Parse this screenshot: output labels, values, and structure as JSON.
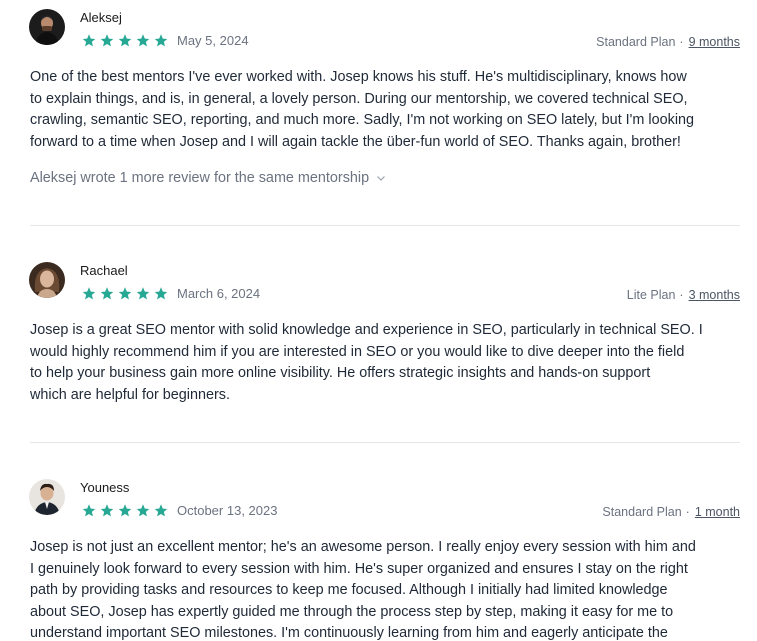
{
  "colors": {
    "star": "#27a894",
    "muted": "#6b7280",
    "text": "#1f2937",
    "divider": "#e5e7eb"
  },
  "reviews": [
    {
      "avatar_icon": "avatar-photo",
      "name": "Aleksej",
      "rating": 5,
      "date": "May 5, 2024",
      "plan": "Standard Plan",
      "separator": "·",
      "duration": "9 months",
      "lines": [
        "One of the best mentors I've ever worked with. Josep knows his stuff. He's multidisciplinary, knows how",
        "to explain things, and is, in general, a lovely person. During our mentorship, we covered technical SEO,",
        "crawling, semantic SEO, reporting, and much more. Sadly, I'm not working on SEO lately, but I'm looking",
        "forward to a time when Josep and I will again tackle the über-fun world of SEO. Thanks again, brother!"
      ],
      "more_reviews": "Aleksej wrote 1 more review for the same mentorship"
    },
    {
      "avatar_icon": "avatar-photo",
      "name": "Rachael",
      "rating": 5,
      "date": "March 6, 2024",
      "plan": "Lite Plan",
      "separator": "·",
      "duration": "3 months",
      "lines": [
        "Josep is a great SEO mentor with solid knowledge and experience in SEO, particularly in technical SEO. I",
        "would highly recommend him if you are interested in SEO or you would like to dive deeper into the field",
        "to help your business gain more online visibility. He offers strategic insights and hands-on support",
        "which are helpful for beginners."
      ]
    },
    {
      "avatar_icon": "avatar-photo",
      "name": "Youness",
      "rating": 5,
      "date": "October 13, 2023",
      "plan": "Standard Plan",
      "separator": "·",
      "duration": "1 month",
      "lines": [
        "Josep is not just an excellent mentor; he's an awesome person. I really enjoy every session with him and",
        "I genuinely look forward to every session with him. He's super organized and ensures I stay on the right",
        "path by providing tasks and resources to keep me focused. Although I initially had limited knowledge",
        "about SEO, Josep has expertly guided me through the process step by step, making it easy for me to",
        "understand important SEO milestones. I'm continuously learning from him and eagerly anticipate the"
      ]
    }
  ]
}
